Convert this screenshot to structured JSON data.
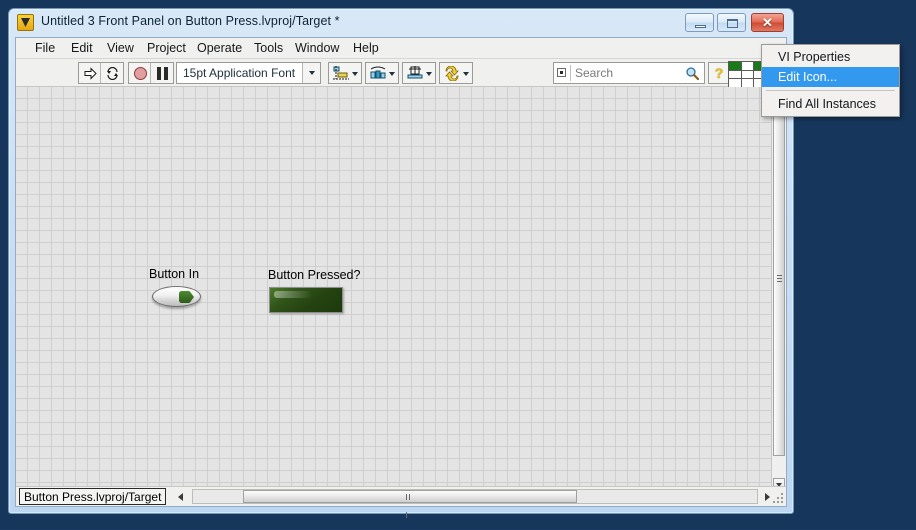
{
  "window": {
    "title": "Untitled 3 Front Panel on Button Press.lvproj/Target *",
    "app_icon": "labview-vi-icon",
    "controls": {
      "minimize": "minimize-button",
      "maximize": "maximize-button",
      "close_glyph": "✕"
    }
  },
  "menubar": {
    "items": [
      {
        "label": "File"
      },
      {
        "label": "Edit"
      },
      {
        "label": "View"
      },
      {
        "label": "Project"
      },
      {
        "label": "Operate"
      },
      {
        "label": "Tools"
      },
      {
        "label": "Window"
      },
      {
        "label": "Help"
      }
    ]
  },
  "toolbar": {
    "run_icon": "run-arrow-icon",
    "run_continuous_icon": "run-continuously-icon",
    "abort_icon": "abort-execution-icon",
    "pause_icon": "pause-icon",
    "font_value": "15pt Application Font",
    "align_icon": "align-objects-icon",
    "distribute_icon": "distribute-objects-icon",
    "resize_icon": "resize-objects-icon",
    "reorder_icon": "reorder-objects-icon",
    "search_placeholder": "Search",
    "search_icon": "magnifier-icon",
    "help_label": "?"
  },
  "panel": {
    "controls": [
      {
        "label": "Button In",
        "type": "rocker-switch",
        "state": "on"
      },
      {
        "label": "Button Pressed?",
        "type": "square-led-indicator",
        "state": "off"
      }
    ]
  },
  "statusbar": {
    "target": "Button Press.lvproj/Target"
  },
  "context_menu": {
    "items": [
      {
        "label": "VI Properties",
        "selected": false,
        "separator_after": false
      },
      {
        "label": "Edit Icon...",
        "selected": true,
        "separator_after": true
      },
      {
        "label": "Find All Instances",
        "selected": false,
        "separator_after": false
      }
    ]
  },
  "colors": {
    "desktop": "#17365c",
    "title_gradient_top": "#d9e8f7",
    "panel_background": "#e4e4e4",
    "grid_line": "#cfcfcf",
    "led_on": "#2c5a18",
    "menu_highlight": "#3399ef",
    "close_button": "#cf4a32"
  }
}
